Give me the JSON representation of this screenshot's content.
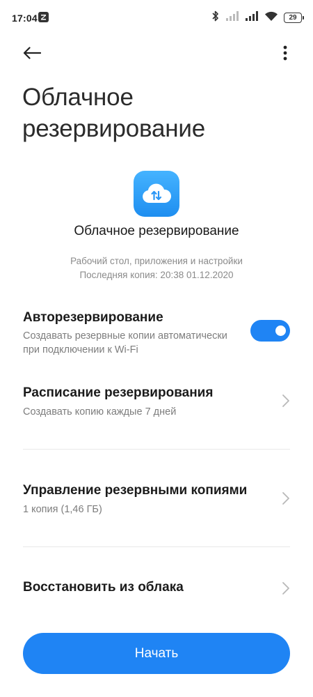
{
  "status_bar": {
    "time": "17:04",
    "battery": "29"
  },
  "header": {
    "title": "Облачное резервирование",
    "back_icon": "arrow-left-icon",
    "more_icon": "more-vertical-icon"
  },
  "hero": {
    "icon": "cloud-sync-icon",
    "title": "Облачное резервирование",
    "subtitle_line1": "Рабочий стол, приложения и настройки",
    "subtitle_line2": "Последняя копия: 20:38 01.12.2020"
  },
  "settings": {
    "auto_backup": {
      "title": "Авторезервирование",
      "subtitle": "Создавать резервные копии автоматически при подключении к Wi-Fi",
      "enabled": true
    },
    "schedule": {
      "title": "Расписание резервирования",
      "subtitle": "Создавать копию каждые 7 дней"
    },
    "manage": {
      "title": "Управление резервными копиями",
      "subtitle": "1 копия (1,46 ГБ)"
    },
    "restore": {
      "title": "Восстановить из облака"
    }
  },
  "actions": {
    "start_label": "Начать"
  },
  "colors": {
    "accent": "#1f84f4"
  }
}
